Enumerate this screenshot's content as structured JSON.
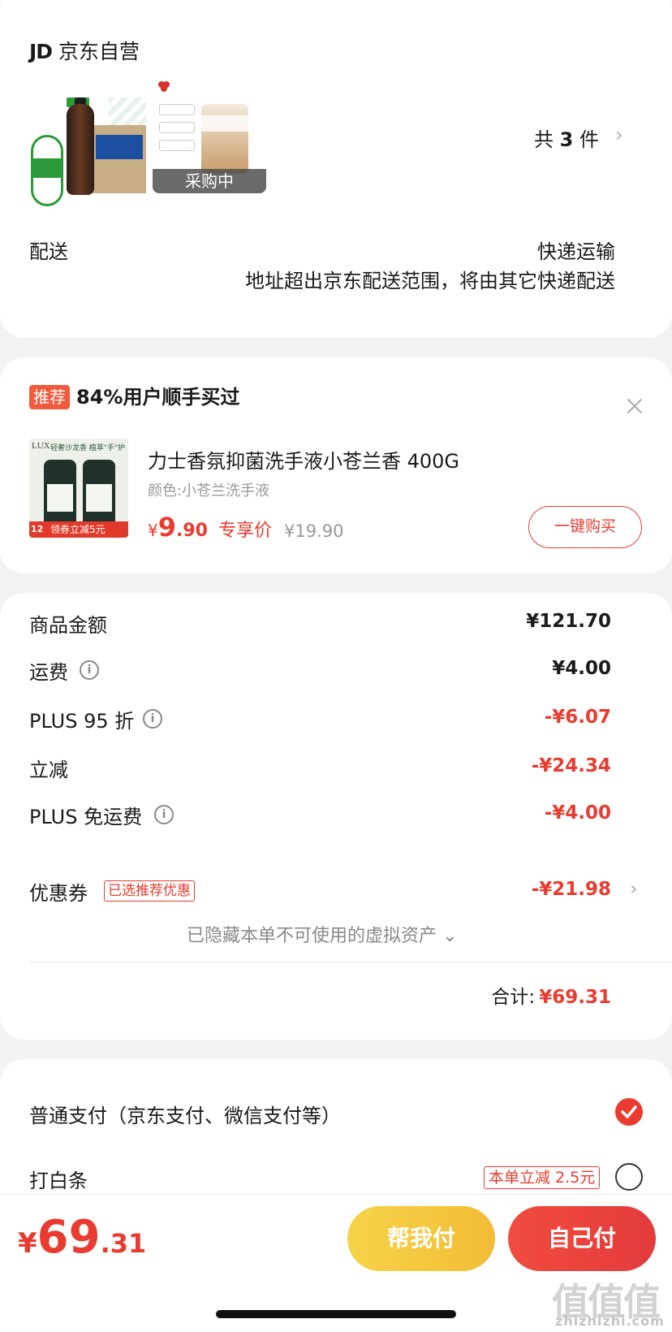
{
  "store": {
    "logo_text": "JD",
    "name": "京东自营",
    "items_prefix": "共",
    "items_count": "3",
    "items_suffix": "件",
    "chevron": "›",
    "buying_label": "采购中"
  },
  "delivery": {
    "label": "配送",
    "method": "快递运输",
    "note": "地址超出京东配送范围，将由其它快递配送"
  },
  "recommend": {
    "badge": "推荐",
    "headline": "84%用户顺手买过",
    "product_name": "力士香氛抑菌洗手液小苍兰香 400G",
    "product_spec": "颜色:小苍兰洗手液",
    "price_symbol": "¥",
    "price_int": "9",
    "price_dec": ".90",
    "price_tag": "专享价",
    "original_price": "¥19.90",
    "buy_button": "一键购买",
    "close_icon": "close-icon",
    "image_brand": "LUX",
    "image_topline": "轻奢沙龙香 植萃\"手\"护",
    "image_promo": "领券立减5元",
    "image_count": "12"
  },
  "summary": {
    "rows": [
      {
        "label": "商品金额",
        "value": "¥121.70",
        "info": false,
        "red": false
      },
      {
        "label": "运费",
        "value": "¥4.00",
        "info": true,
        "red": false
      },
      {
        "label": "PLUS 95 折",
        "value": "-¥6.07",
        "info": true,
        "red": true
      },
      {
        "label": "立减",
        "value": "-¥24.34",
        "info": false,
        "red": true
      },
      {
        "label": "PLUS 免运费",
        "value": "-¥4.00",
        "info": true,
        "red": true
      }
    ],
    "coupon_label": "优惠券",
    "coupon_tag": "已选推荐优惠",
    "coupon_value": "-¥21.98",
    "hidden_assets": "已隐藏本单不可使用的虚拟资产",
    "hidden_chevron": "⌄",
    "total_label": "合计:",
    "total_value": "¥69.31"
  },
  "payment": {
    "option1": "普通支付（京东支付、微信支付等）",
    "option1_selected": true,
    "option2": "打白条",
    "option2_tag": "本单立减 2.5元",
    "option2_selected": false
  },
  "bottom": {
    "currency": "¥",
    "price_int": "69",
    "price_dec": ".31",
    "help_pay": "帮我付",
    "self_pay": "自己付"
  },
  "watermark": {
    "big": "值值值",
    "small": "zhizhizhi.com"
  },
  "colors": {
    "accent_red": "#e93b2f",
    "help_yellow": "#f2c53d",
    "background": "#f2f2f2"
  }
}
